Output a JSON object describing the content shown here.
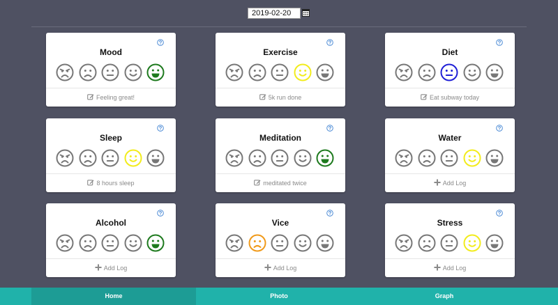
{
  "date": {
    "value": "2019-02-20"
  },
  "icons": {
    "calendar": "calendar-icon",
    "help": "question-circle-icon",
    "note": "pencil-square-icon",
    "add": "plus-icon"
  },
  "face_levels": [
    "very-sad",
    "sad",
    "neutral",
    "happy",
    "very-happy"
  ],
  "colors": {
    "face_default": "#777777",
    "very-happy": "#1e7a1e",
    "happy": "#f2ec1c",
    "neutral": "#1f1fd6",
    "sad": "#f09a1a",
    "accent": "#20b2aa",
    "accent_active": "#1d9c95"
  },
  "cards": [
    {
      "title": "Mood",
      "selected": 4,
      "note": "Feeling great!",
      "note_kind": "note"
    },
    {
      "title": "Exercise",
      "selected": 3,
      "note": "5k run done",
      "note_kind": "note"
    },
    {
      "title": "Diet",
      "selected": 2,
      "note": "Eat subway today",
      "note_kind": "note"
    },
    {
      "title": "Sleep",
      "selected": 3,
      "note": "8 hours sleep",
      "note_kind": "note"
    },
    {
      "title": "Meditation",
      "selected": 4,
      "note": "meditated twice",
      "note_kind": "note"
    },
    {
      "title": "Water",
      "selected": 3,
      "note": "Add Log",
      "note_kind": "add"
    },
    {
      "title": "Alcohol",
      "selected": 4,
      "note": "Add Log",
      "note_kind": "add"
    },
    {
      "title": "Vice",
      "selected": 1,
      "note": "Add Log",
      "note_kind": "add"
    },
    {
      "title": "Stress",
      "selected": 3,
      "note": "Add Log",
      "note_kind": "add"
    }
  ],
  "nav": {
    "tabs": [
      {
        "label": "Home",
        "active": true
      },
      {
        "label": "Photo",
        "active": false
      },
      {
        "label": "Graph",
        "active": false
      }
    ]
  }
}
